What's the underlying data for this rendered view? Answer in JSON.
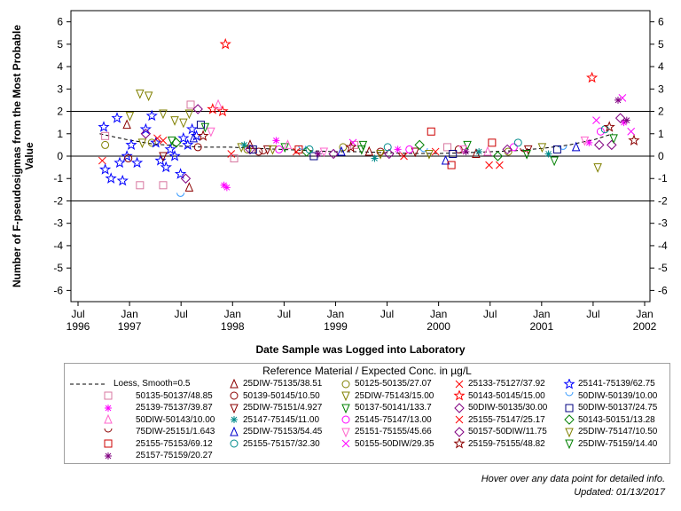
{
  "chart_data": {
    "type": "scatter",
    "title": "",
    "xlabel": "Date Sample was Logged into Laboratory",
    "ylabel_lines": [
      "Number of F-pseudosigmas from the Most Probable",
      "Value"
    ],
    "ylim": [
      -6.5,
      6.5
    ],
    "yticks": [
      "-6",
      "-5",
      "-4",
      "-3",
      "-2",
      "-1",
      "0",
      "1",
      "2",
      "3",
      "4",
      "5",
      "6"
    ],
    "reference_lines": [
      0,
      2,
      -2
    ],
    "xlim_months": [
      "1996-07",
      "2002-01"
    ],
    "xticks_top": [
      "Jul",
      "Jan",
      "Jul",
      "Jan",
      "Jul",
      "Jan",
      "Jul",
      "Jan",
      "Jul",
      "Jan",
      "Jul",
      "Jan"
    ],
    "xticks_bottom": [
      "1996",
      "1997",
      "",
      "1998",
      "",
      "1999",
      "",
      "2000",
      "",
      "2001",
      "",
      "2002"
    ],
    "loess": {
      "label": "Loess, Smooth=0.5",
      "x": [
        "1996-10",
        "1997-01",
        "1997-04",
        "1997-07",
        "1997-10",
        "1998-01",
        "1998-04",
        "1998-07",
        "1998-10",
        "1999-01",
        "1999-04",
        "1999-07",
        "1999-10",
        "2000-01",
        "2000-04",
        "2000-07",
        "2000-10",
        "2001-01",
        "2001-04",
        "2001-07",
        "2001-09"
      ],
      "y": [
        1.0,
        0.75,
        0.55,
        0.45,
        0.4,
        0.4,
        0.35,
        0.3,
        0.25,
        0.2,
        0.2,
        0.15,
        0.12,
        0.12,
        0.15,
        0.2,
        0.25,
        0.35,
        0.5,
        0.75,
        1.0
      ]
    },
    "series": [
      {
        "name": "25DIW-75135/38.51",
        "marker": "triangle",
        "color": "#8b0000",
        "points": [
          [
            "1997-01-05",
            1.4
          ],
          [
            "1997-08-10",
            -1.4
          ],
          [
            "1998-03-10",
            0.5
          ],
          [
            "1999-05-01",
            0.2
          ],
          [
            "2000-05-10",
            0.1
          ]
        ]
      },
      {
        "name": "50125-50135/27.07",
        "marker": "circle",
        "color": "#808000",
        "points": [
          [
            "1996-10-20",
            0.5
          ],
          [
            "1997-04-01",
            0.6
          ],
          [
            "1998-03-01",
            0.3
          ],
          [
            "1999-02-01",
            0.4
          ],
          [
            "2000-09-01",
            0.2
          ]
        ]
      },
      {
        "name": "25133-75127/37.92",
        "marker": "x",
        "color": "#ff0000",
        "points": [
          [
            "1996-10-10",
            -0.2
          ],
          [
            "1997-05-10",
            0.7
          ],
          [
            "1998-01-05",
            0.1
          ],
          [
            "1999-09-01",
            0.0
          ],
          [
            "2000-08-01",
            -0.4
          ]
        ]
      },
      {
        "name": "25141-75139/62.75",
        "marker": "star",
        "color": "#0000ff",
        "points": [
          [
            "1996-10-15",
            1.3
          ],
          [
            "1996-10-20",
            -0.6
          ],
          [
            "1996-11-10",
            -1.0
          ],
          [
            "1996-12-01",
            1.7
          ],
          [
            "1996-12-10",
            -0.3
          ],
          [
            "1996-12-20",
            -1.1
          ],
          [
            "1997-01-05",
            0.0
          ],
          [
            "1997-01-20",
            0.5
          ],
          [
            "1997-02-10",
            -0.3
          ],
          [
            "1997-03-10",
            1.2
          ],
          [
            "1997-04-01",
            1.8
          ],
          [
            "1997-04-15",
            0.6
          ],
          [
            "1997-05-01",
            -0.2
          ],
          [
            "1997-05-20",
            -0.5
          ],
          [
            "1997-06-05",
            0.3
          ],
          [
            "1997-06-20",
            0.0
          ],
          [
            "1997-07-10",
            -0.8
          ],
          [
            "1997-07-20",
            0.8
          ],
          [
            "1997-08-05",
            0.5
          ],
          [
            "1997-08-20",
            1.2
          ],
          [
            "1997-09-05",
            0.9
          ]
        ]
      },
      {
        "name": "50135-50137/48.85",
        "marker": "square",
        "color": "#d877a0",
        "points": [
          [
            "1996-10-20",
            0.9
          ],
          [
            "1997-02-20",
            -1.3
          ],
          [
            "1997-05-10",
            -1.3
          ],
          [
            "1997-08-15",
            2.3
          ],
          [
            "1998-01-15",
            -0.1
          ],
          [
            "1999-03-10",
            0.5
          ],
          [
            "2000-02-01",
            0.4
          ]
        ]
      },
      {
        "name": "50139-50145/10.50",
        "marker": "circle",
        "color": "#8b0000",
        "points": [
          [
            "1997-01-10",
            -0.1
          ],
          [
            "1997-09-10",
            0.4
          ],
          [
            "1998-04-10",
            0.2
          ],
          [
            "1999-06-10",
            0.2
          ],
          [
            "2000-03-10",
            0.3
          ]
        ]
      },
      {
        "name": "25DIW-75143/15.00",
        "marker": "triangle-down",
        "color": "#808000",
        "points": [
          [
            "1997-01-15",
            1.8
          ],
          [
            "1997-02-20",
            2.8
          ],
          [
            "1997-03-20",
            2.7
          ],
          [
            "1997-05-10",
            1.9
          ],
          [
            "1997-06-20",
            1.6
          ],
          [
            "1997-07-20",
            1.5
          ],
          [
            "1997-08-10",
            1.9
          ],
          [
            "1998-02-10",
            0.4
          ],
          [
            "1999-06-10",
            0.1
          ],
          [
            "2001-07-10",
            -0.5
          ]
        ]
      },
      {
        "name": "50143-50145/15.00",
        "marker": "star",
        "color": "#ff0000",
        "points": [
          [
            "1997-11-01",
            2.1
          ],
          [
            "1997-12-05",
            2.0
          ],
          [
            "1997-12-15",
            5.0
          ],
          [
            "2001-06-20",
            3.5
          ]
        ]
      },
      {
        "name": "50DIW-50139/10.00",
        "marker": "cup",
        "color": "#3399ff",
        "points": [
          [
            "1997-07-10",
            -1.8
          ],
          [
            "1998-09-10",
            0.3
          ],
          [
            "1999-11-10",
            0.2
          ],
          [
            "2001-03-10",
            0.3
          ]
        ]
      },
      {
        "name": "25139-75137/39.87",
        "marker": "asterisk",
        "color": "#ff00ff",
        "points": [
          [
            "1997-12-10",
            -1.3
          ],
          [
            "1997-12-20",
            -1.4
          ],
          [
            "1998-06-10",
            0.7
          ],
          [
            "1999-08-10",
            0.3
          ],
          [
            "2001-06-10",
            0.6
          ],
          [
            "2001-10-10",
            1.5
          ]
        ]
      },
      {
        "name": "25DIW-75151/4.927",
        "marker": "triangle-down",
        "color": "#8b0000",
        "points": [
          [
            "1997-05-10",
            0.0
          ],
          [
            "1998-05-10",
            0.3
          ],
          [
            "1999-10-10",
            0.2
          ],
          [
            "2000-11-10",
            0.3
          ]
        ]
      },
      {
        "name": "50137-50141/133.7",
        "marker": "triangle-down",
        "color": "#008000",
        "points": [
          [
            "1997-06-10",
            0.7
          ],
          [
            "1998-07-10",
            0.4
          ],
          [
            "1999-04-10",
            0.5
          ],
          [
            "2000-04-10",
            0.5
          ],
          [
            "2001-02-10",
            -0.2
          ]
        ]
      },
      {
        "name": "50DIW-50135/30.00",
        "marker": "diamond",
        "color": "#800080",
        "points": [
          [
            "1997-03-10",
            1.0
          ],
          [
            "1997-09-10",
            2.1
          ],
          [
            "1998-03-10",
            0.3
          ],
          [
            "1999-07-10",
            0.1
          ],
          [
            "2001-07-15",
            0.5
          ]
        ]
      },
      {
        "name": "50DIW-50137/24.75",
        "marker": "square",
        "color": "#000080",
        "points": [
          [
            "1997-09-20",
            1.4
          ],
          [
            "1998-03-20",
            0.3
          ],
          [
            "1998-10-20",
            0.0
          ],
          [
            "2000-02-20",
            0.1
          ],
          [
            "2001-02-20",
            0.3
          ]
        ]
      },
      {
        "name": "50DIW-50143/10.00",
        "marker": "triangle",
        "color": "#ff66cc",
        "points": [
          [
            "1997-11-20",
            2.3
          ],
          [
            "1998-07-20",
            0.5
          ],
          [
            "2000-06-20",
            0.2
          ]
        ]
      },
      {
        "name": "25147-75145/11.00",
        "marker": "asterisk",
        "color": "#008b8b",
        "points": [
          [
            "1998-02-20",
            0.5
          ],
          [
            "1999-05-20",
            -0.1
          ],
          [
            "2000-05-20",
            0.2
          ],
          [
            "2001-01-20",
            0.1
          ]
        ]
      },
      {
        "name": "25145-75147/13.00",
        "marker": "circle",
        "color": "#ff00ff",
        "points": [
          [
            "1998-06-20",
            0.3
          ],
          [
            "1999-09-20",
            0.3
          ],
          [
            "2000-09-20",
            0.4
          ],
          [
            "2001-07-20",
            1.1
          ]
        ]
      },
      {
        "name": "25155-75147/25.17",
        "marker": "x",
        "color": "#ff0000",
        "points": [
          [
            "1997-04-20",
            0.8
          ],
          [
            "1998-08-20",
            0.2
          ],
          [
            "1999-12-20",
            0.2
          ],
          [
            "2000-06-25",
            -0.4
          ]
        ]
      },
      {
        "name": "50143-50151/13.28",
        "marker": "diamond",
        "color": "#008000",
        "points": [
          [
            "1997-06-25",
            0.6
          ],
          [
            "1998-09-25",
            0.2
          ],
          [
            "1999-10-25",
            0.5
          ],
          [
            "2000-07-25",
            0.0
          ]
        ]
      },
      {
        "name": "75DIW-25151/1.643",
        "marker": "cup",
        "color": "#8b0000",
        "points": [
          [
            "1998-04-25",
            0.1
          ],
          [
            "1999-08-25",
            0.0
          ],
          [
            "2000-10-25",
            0.2
          ]
        ]
      },
      {
        "name": "25DIW-75153/54.45",
        "marker": "triangle",
        "color": "#0000cd",
        "points": [
          [
            "1997-08-25",
            0.8
          ],
          [
            "1999-01-25",
            0.2
          ],
          [
            "2000-01-25",
            -0.2
          ],
          [
            "2001-04-25",
            0.4
          ]
        ]
      },
      {
        "name": "25151-75155/45.66",
        "marker": "triangle-down",
        "color": "#ff66cc",
        "points": [
          [
            "1997-10-25",
            1.1
          ],
          [
            "1998-11-25",
            0.2
          ],
          [
            "2000-03-25",
            0.3
          ],
          [
            "2001-05-25",
            0.7
          ]
        ]
      },
      {
        "name": "50157-50DIW/11.75",
        "marker": "diamond",
        "color": "#800080",
        "points": [
          [
            "1997-07-28",
            -1.0
          ],
          [
            "1998-12-28",
            0.1
          ],
          [
            "2000-08-28",
            0.3
          ],
          [
            "2001-08-28",
            0.5
          ],
          [
            "2001-09-28",
            1.7
          ]
        ]
      },
      {
        "name": "25DIW-75147/10.50",
        "marker": "triangle-down",
        "color": "#808000",
        "points": [
          [
            "1997-02-28",
            0.6
          ],
          [
            "1998-05-28",
            0.3
          ],
          [
            "1999-11-28",
            0.1
          ],
          [
            "2000-12-28",
            0.4
          ]
        ]
      },
      {
        "name": "25155-75153/69.12",
        "marker": "square",
        "color": "#cc0000",
        "points": [
          [
            "1998-08-28",
            0.3
          ],
          [
            "1999-12-05",
            1.1
          ],
          [
            "2000-02-15",
            -0.4
          ],
          [
            "2000-07-05",
            0.6
          ]
        ]
      },
      {
        "name": "25155-75157/32.30",
        "marker": "circle",
        "color": "#008b8b",
        "points": [
          [
            "1998-10-05",
            0.3
          ],
          [
            "1999-07-05",
            0.4
          ],
          [
            "2000-10-05",
            0.6
          ],
          [
            "2001-08-05",
            1.2
          ]
        ]
      },
      {
        "name": "50155-50DIW/29.35",
        "marker": "x",
        "color": "#ff00ff",
        "points": [
          [
            "1999-03-05",
            0.6
          ],
          [
            "2001-07-05",
            1.6
          ],
          [
            "2001-10-05",
            2.6
          ],
          [
            "2001-11-05",
            1.1
          ]
        ]
      },
      {
        "name": "25159-75155/48.82",
        "marker": "star",
        "color": "#8b0000",
        "points": [
          [
            "1997-09-28",
            0.9
          ],
          [
            "1999-02-28",
            0.4
          ],
          [
            "2001-08-20",
            1.3
          ],
          [
            "2001-11-15",
            0.7
          ]
        ]
      },
      {
        "name": "25DIW-75159/14.40",
        "marker": "triangle-down",
        "color": "#008000",
        "points": [
          [
            "1997-10-05",
            1.3
          ],
          [
            "1999-04-05",
            0.3
          ],
          [
            "2000-11-05",
            0.1
          ],
          [
            "2001-09-05",
            0.8
          ]
        ]
      },
      {
        "name": "25157-75159/20.27",
        "marker": "asterisk",
        "color": "#800080",
        "points": [
          [
            "1998-11-05",
            0.1
          ],
          [
            "2000-04-05",
            0.2
          ],
          [
            "2001-09-20",
            2.5
          ],
          [
            "2001-10-20",
            1.6
          ]
        ]
      }
    ]
  },
  "legend": {
    "title": "Reference Material / Expected Conc. in µg/L",
    "loess_label": "Loess, Smooth=0.5"
  },
  "footer": {
    "hover_note": "Hover over any data point for detailed info.",
    "updated": "Updated: 01/13/2017"
  }
}
